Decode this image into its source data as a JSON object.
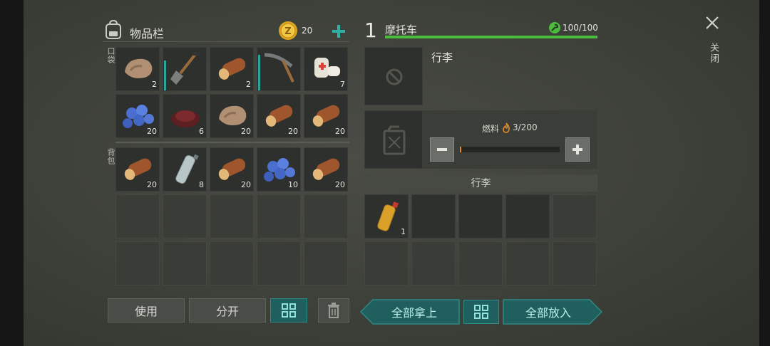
{
  "inventory": {
    "title": "物品栏",
    "coins": "20",
    "pocket_label": "口袋",
    "backpack_label": "背包",
    "pocket_items": [
      {
        "name": "stone",
        "count": "2"
      },
      {
        "name": "shovel",
        "count": ""
      },
      {
        "name": "log",
        "count": "2"
      },
      {
        "name": "pickaxe",
        "count": ""
      },
      {
        "name": "bandage",
        "count": "7"
      },
      {
        "name": "blueberries",
        "count": "20"
      },
      {
        "name": "seeds",
        "count": "6"
      },
      {
        "name": "stone",
        "count": "20"
      },
      {
        "name": "log",
        "count": "20"
      },
      {
        "name": "log",
        "count": "20"
      }
    ],
    "backpack_items": [
      {
        "name": "log",
        "count": "20"
      },
      {
        "name": "water-bottle",
        "count": "8"
      },
      {
        "name": "log",
        "count": "20"
      },
      {
        "name": "blueberries",
        "count": "10"
      },
      {
        "name": "log",
        "count": "20"
      }
    ],
    "use_label": "使用",
    "split_label": "分开"
  },
  "vehicle": {
    "level": "1",
    "name": "摩托车",
    "durability": "100/100",
    "durability_fraction": 1.0,
    "luggage_title": "行李",
    "fuel_label": "燃料",
    "fuel_value": "3/200",
    "fuel_fraction": 0.015,
    "luggage_section_label": "行李",
    "luggage_items": [
      {
        "name": "fuel-bottle",
        "count": "1"
      }
    ]
  },
  "actions": {
    "take_all": "全部拿上",
    "put_all": "全部放入",
    "close": "关闭"
  },
  "colors": {
    "accent_teal": "#2aa59c",
    "durability_green": "#4cbc3e",
    "fuel_orange": "#e08a2a"
  }
}
